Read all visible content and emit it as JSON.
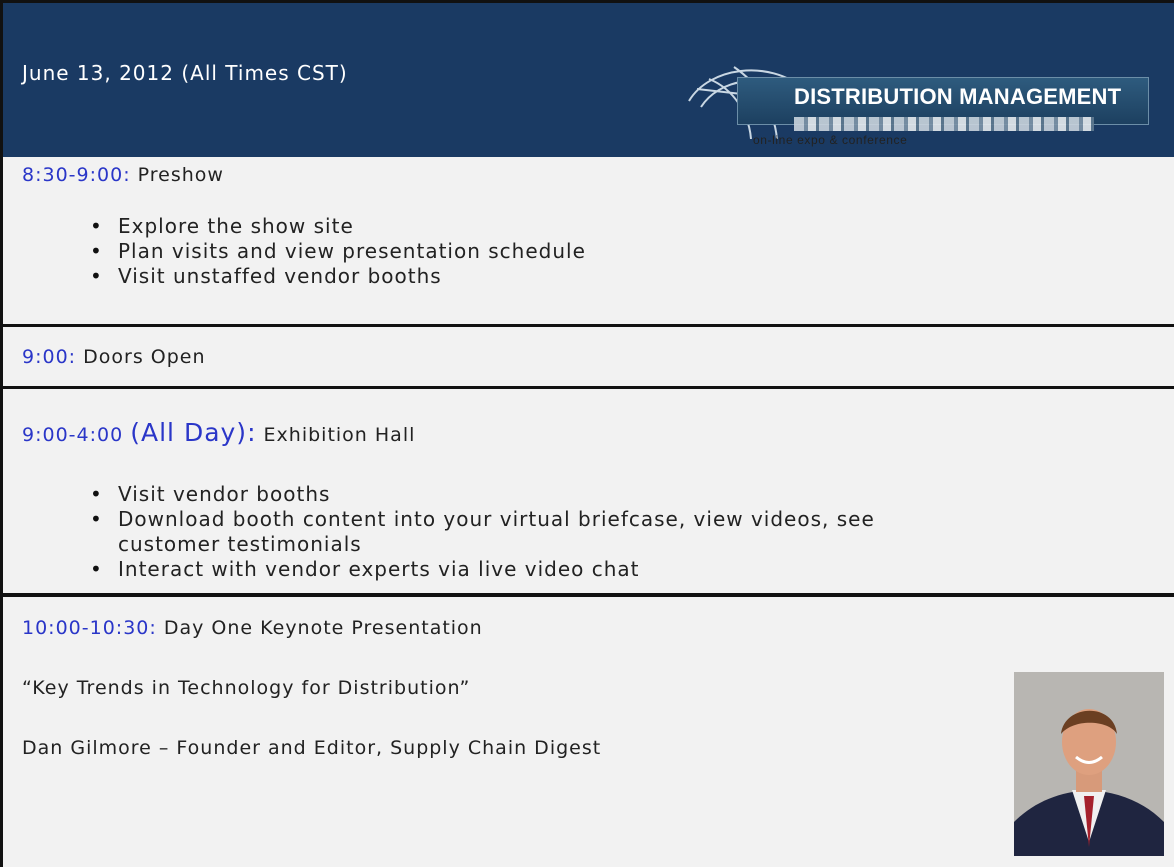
{
  "header": {
    "date_text": "June 13, 2012 (All Times CST)",
    "logo_text": "DISTRIBUTION MANAGEMENT",
    "logo_tagline": "on-line expo & conference"
  },
  "schedule": [
    {
      "time": "8:30-9:00:",
      "title": "Preshow",
      "bullets": [
        "Explore the show site",
        "Plan visits and view presentation schedule",
        "Visit unstaffed vendor booths"
      ]
    },
    {
      "time": "9:00:",
      "title": "Doors Open"
    },
    {
      "time": "9:00-4:00",
      "time_emph": "(All Day):",
      "title": "Exhibition Hall",
      "bullets": [
        "Visit vendor booths",
        "Download booth content into your virtual briefcase, view videos, see",
        "customer testimonials",
        "Interact with vendor experts via live video chat"
      ]
    },
    {
      "time": "10:00-10:30:",
      "title": "Day One Keynote Presentation",
      "quote": "“Key Trends in Technology for Distribution”",
      "speaker": "Dan Gilmore – Founder and Editor, Supply Chain Digest"
    }
  ],
  "colors": {
    "header_bg": "#1a3a63",
    "time_blue": "#2a36c8",
    "body_bg": "#f2f2f2"
  }
}
